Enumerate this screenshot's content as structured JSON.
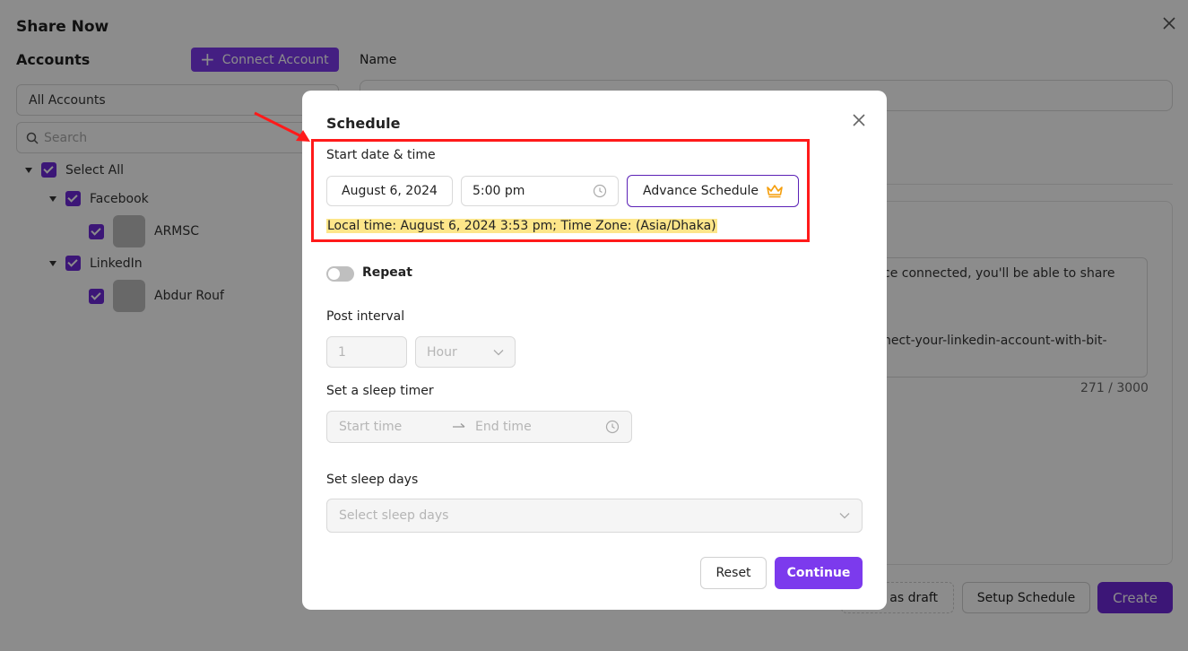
{
  "background": {
    "page_title": "Share Now",
    "accounts_heading": "Accounts",
    "connect_account": "Connect Account",
    "name_label": "Name",
    "account_filter": "All Accounts",
    "search_placeholder": "Search",
    "tree": {
      "select_all": "Select All",
      "facebook": "Facebook",
      "facebook_account": "ARMSC",
      "linkedin": "LinkedIn",
      "linkedin_account": "Abdur Rouf"
    },
    "content_line1": "ce connected, you'll be able to share",
    "content_line2": "nect-your-linkedin-account-with-bit-",
    "char_count": "271 / 3000",
    "save_draft": "as draft",
    "setup_schedule": "Setup Schedule",
    "create": "Create"
  },
  "modal": {
    "title": "Schedule",
    "start_label": "Start date & time",
    "date_value": "August 6, 2024",
    "time_value": "5:00 pm",
    "advance_schedule": "Advance Schedule",
    "local_time": "Local time: August 6, 2024 3:53 pm; Time Zone: (Asia/Dhaka)",
    "repeat_label": "Repeat",
    "repeat_on": false,
    "post_interval_label": "Post interval",
    "interval_value": "1",
    "interval_unit": "Hour",
    "sleep_timer_label": "Set a sleep timer",
    "start_time_placeholder": "Start time",
    "end_time_placeholder": "End time",
    "sleep_days_label": "Set sleep days",
    "sleep_days_placeholder": "Select sleep days",
    "reset": "Reset",
    "continue": "Continue"
  },
  "colors": {
    "accent": "#7c3aed",
    "highlight": "#fde68a",
    "annotation": "#ff1a1a",
    "crown": "#f59e0b"
  }
}
